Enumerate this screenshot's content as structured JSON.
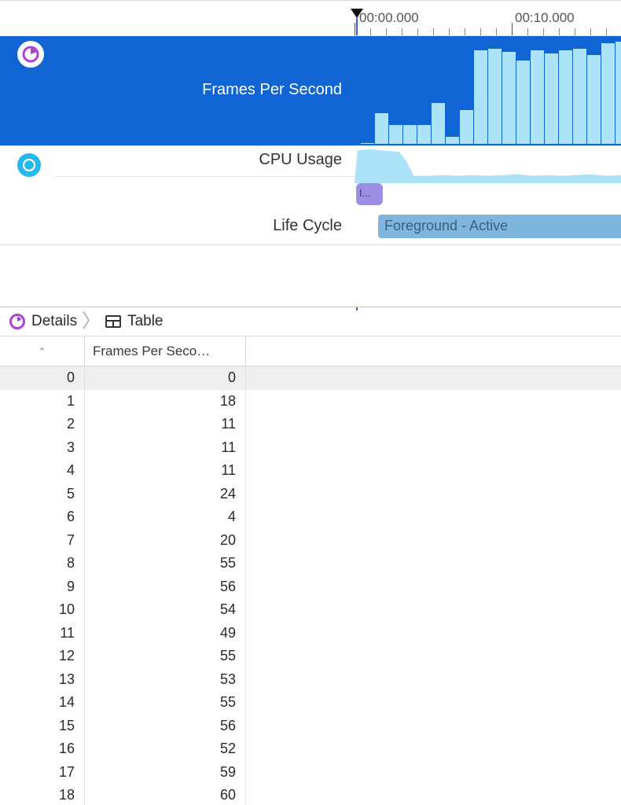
{
  "ruler": {
    "ticks": [
      "00:00.000",
      "00:10.000"
    ]
  },
  "tracks": {
    "fps": {
      "title": "Frames Per Second"
    },
    "cpu": {
      "title": "CPU Usage"
    },
    "life": {
      "title": "Life Cycle",
      "pill_small": "I...",
      "pill_large": "Foreground - Active"
    }
  },
  "breadcrumb": {
    "details": "Details",
    "table": "Table"
  },
  "table": {
    "columns": {
      "index_sort": "⌃",
      "fps": "Frames Per Seco…"
    },
    "rows": [
      {
        "i": 0,
        "v": 0
      },
      {
        "i": 1,
        "v": 18
      },
      {
        "i": 2,
        "v": 11
      },
      {
        "i": 3,
        "v": 11
      },
      {
        "i": 4,
        "v": 11
      },
      {
        "i": 5,
        "v": 24
      },
      {
        "i": 6,
        "v": 4
      },
      {
        "i": 7,
        "v": 20
      },
      {
        "i": 8,
        "v": 55
      },
      {
        "i": 9,
        "v": 56
      },
      {
        "i": 10,
        "v": 54
      },
      {
        "i": 11,
        "v": 49
      },
      {
        "i": 12,
        "v": 55
      },
      {
        "i": 13,
        "v": 53
      },
      {
        "i": 14,
        "v": 55
      },
      {
        "i": 15,
        "v": 56
      },
      {
        "i": 16,
        "v": 52
      },
      {
        "i": 17,
        "v": 59
      },
      {
        "i": 18,
        "v": 60
      }
    ]
  },
  "chart_data": [
    {
      "type": "bar",
      "title": "Frames Per Second",
      "xlabel": "",
      "ylabel": "",
      "ylim": [
        0,
        60
      ],
      "categories": [
        0,
        1,
        2,
        3,
        4,
        5,
        6,
        7,
        8,
        9,
        10,
        11,
        12,
        13,
        14,
        15,
        16,
        17,
        18
      ],
      "values": [
        0,
        18,
        11,
        11,
        11,
        24,
        4,
        20,
        55,
        56,
        54,
        49,
        55,
        53,
        55,
        56,
        52,
        59,
        60
      ]
    },
    {
      "type": "area",
      "title": "CPU Usage",
      "xlabel": "",
      "ylabel": "",
      "ylim": [
        0,
        100
      ],
      "x": [
        0.0,
        0.2,
        0.5,
        1.0,
        1.5,
        2.0,
        3.0,
        3.5,
        4.0,
        5.0,
        6.0,
        7.0,
        8.0,
        9.0,
        10.0,
        11.0,
        12.0,
        13.0,
        14.0,
        15.0,
        16.0,
        17.0,
        18.0
      ],
      "values": [
        0,
        88,
        90,
        92,
        90,
        88,
        85,
        60,
        20,
        20,
        22,
        20,
        22,
        20,
        22,
        24,
        20,
        22,
        20,
        22,
        24,
        20,
        22
      ]
    }
  ]
}
